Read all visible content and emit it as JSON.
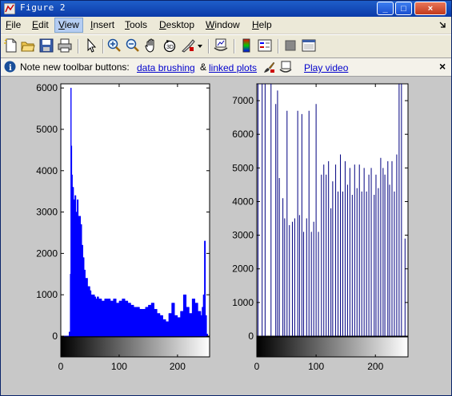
{
  "window": {
    "title": "Figure 2",
    "minimize": "_",
    "maximize": "□",
    "close": "×"
  },
  "menu": [
    {
      "label": "File",
      "u": "F",
      "rest": "ile"
    },
    {
      "label": "Edit",
      "u": "E",
      "rest": "dit"
    },
    {
      "label": "View",
      "u": "V",
      "rest": "iew"
    },
    {
      "label": "Insert",
      "u": "I",
      "rest": "nsert"
    },
    {
      "label": "Tools",
      "u": "T",
      "rest": "ools"
    },
    {
      "label": "Desktop",
      "u": "D",
      "rest": "esktop"
    },
    {
      "label": "Window",
      "u": "W",
      "rest": "indow"
    },
    {
      "label": "Help",
      "u": "H",
      "rest": "elp"
    }
  ],
  "infobar": {
    "text": "Note new toolbar buttons:",
    "link1": "data brushing",
    "amp": "&",
    "link2": "linked plots",
    "link3": "Play video",
    "close": "×"
  },
  "chart_data": [
    {
      "type": "bar",
      "ylim": [
        0,
        6100
      ],
      "xlim": [
        0,
        255
      ],
      "yticks": [
        "0",
        "1000",
        "2000",
        "3000",
        "4000",
        "5000",
        "6000"
      ],
      "ytick_values": [
        0,
        1000,
        2000,
        3000,
        4000,
        5000,
        6000
      ],
      "xticks": [
        "0",
        "100",
        "200"
      ],
      "xtick_values": [
        0,
        100,
        200
      ],
      "color": "#0000ff",
      "x": [
        0,
        5,
        10,
        14,
        16,
        17,
        18,
        19,
        20,
        22,
        24,
        26,
        28,
        30,
        32,
        34,
        36,
        38,
        40,
        42,
        44,
        46,
        48,
        50,
        52,
        54,
        56,
        58,
        60,
        62,
        65,
        70,
        75,
        80,
        85,
        90,
        95,
        100,
        105,
        110,
        115,
        120,
        125,
        130,
        135,
        140,
        145,
        150,
        155,
        160,
        165,
        170,
        175,
        180,
        185,
        190,
        195,
        200,
        205,
        210,
        215,
        220,
        225,
        230,
        235,
        240,
        242,
        244,
        246,
        248,
        250,
        252,
        255
      ],
      "values": [
        0,
        0,
        0,
        100,
        1500,
        6000,
        4600,
        3900,
        3600,
        3300,
        3400,
        3000,
        3300,
        2900,
        2900,
        2700,
        2200,
        1900,
        1600,
        1400,
        1400,
        1200,
        1200,
        1100,
        1000,
        1000,
        1000,
        950,
        900,
        950,
        900,
        850,
        900,
        900,
        850,
        900,
        800,
        850,
        900,
        850,
        800,
        750,
        700,
        700,
        650,
        650,
        700,
        750,
        800,
        650,
        550,
        500,
        400,
        350,
        550,
        800,
        500,
        450,
        600,
        1000,
        700,
        550,
        900,
        800,
        600,
        500,
        700,
        1000,
        2300,
        500,
        50,
        0,
        0
      ]
    },
    {
      "type": "bar",
      "ylim": [
        0,
        7500
      ],
      "xlim": [
        0,
        255
      ],
      "yticks": [
        "0",
        "1000",
        "2000",
        "3000",
        "4000",
        "5000",
        "6000",
        "7000"
      ],
      "ytick_values": [
        0,
        1000,
        2000,
        3000,
        4000,
        5000,
        6000,
        7000
      ],
      "xticks": [
        "0",
        "100",
        "200"
      ],
      "xtick_values": [
        0,
        100,
        200
      ],
      "color": "#000080",
      "x": [
        2,
        9,
        14,
        24,
        32,
        35,
        38,
        44,
        47,
        51,
        55,
        60,
        64,
        69,
        72,
        76,
        79,
        84,
        88,
        92,
        96,
        100,
        104,
        109,
        113,
        117,
        121,
        125,
        128,
        133,
        137,
        141,
        145,
        149,
        153,
        157,
        161,
        165,
        169,
        173,
        177,
        181,
        185,
        189,
        193,
        198,
        201,
        205,
        209,
        213,
        216,
        221,
        224,
        228,
        232,
        236,
        240,
        244,
        250
      ],
      "values": [
        7500,
        7500,
        7500,
        7500,
        6900,
        7300,
        4700,
        4100,
        3500,
        6700,
        3300,
        3400,
        3500,
        6700,
        3600,
        6600,
        3100,
        3500,
        6700,
        3100,
        3400,
        6900,
        3100,
        4800,
        5100,
        4800,
        5200,
        3800,
        4600,
        5100,
        4300,
        5400,
        4300,
        5200,
        4500,
        5000,
        4200,
        5100,
        4400,
        5100,
        4300,
        5000,
        4300,
        4800,
        5000,
        4200,
        4800,
        4400,
        5300,
        5000,
        4800,
        5200,
        4500,
        5200,
        4300,
        5400,
        7500,
        7500,
        2900
      ]
    }
  ]
}
